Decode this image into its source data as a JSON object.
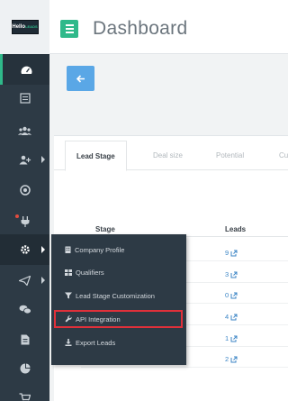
{
  "app": {
    "logo_text": "Hello",
    "logo_subtext": "LEADS",
    "accent_color": "#2fb98a",
    "sidebar_color": "#2d3a45"
  },
  "header": {
    "title": "Dashboard",
    "menu_icon": "hamburger-icon"
  },
  "back_button": {
    "icon": "arrow-left-icon"
  },
  "sidebar": {
    "items": [
      {
        "icon": "speedometer-icon",
        "active": true
      },
      {
        "icon": "list-card-icon"
      },
      {
        "icon": "users-group-icon"
      },
      {
        "icon": "user-plus-icon",
        "has_submenu": true
      },
      {
        "icon": "target-icon"
      },
      {
        "icon": "plug-icon",
        "notification": true
      },
      {
        "icon": "gear-icon",
        "has_submenu": true,
        "highlighted": true
      },
      {
        "icon": "send-icon",
        "has_submenu": true
      },
      {
        "icon": "chat-bubbles-icon"
      },
      {
        "icon": "document-icon"
      },
      {
        "icon": "pie-chart-icon"
      },
      {
        "icon": "cart-icon"
      }
    ]
  },
  "tabs": [
    {
      "label": "Lead Stage",
      "active": true
    },
    {
      "label": "Deal size"
    },
    {
      "label": "Potential"
    },
    {
      "label": "Cu"
    }
  ],
  "table": {
    "columns": [
      "Stage",
      "Leads"
    ],
    "rows": [
      {
        "leads": "9"
      },
      {
        "leads": "3"
      },
      {
        "leads": "0"
      },
      {
        "leads": "4"
      },
      {
        "leads": "1"
      },
      {
        "leads": "2"
      }
    ],
    "link_icon": "external-link-icon"
  },
  "settings_menu": {
    "items": [
      {
        "label": "Company Profile",
        "icon": "building-icon"
      },
      {
        "label": "Qualifiers",
        "icon": "grid-icon"
      },
      {
        "label": "Lead Stage Customization",
        "icon": "filter-icon"
      },
      {
        "label": "API Integration",
        "icon": "wrench-icon",
        "selected": true
      },
      {
        "label": "Export Leads",
        "icon": "download-icon"
      }
    ]
  }
}
